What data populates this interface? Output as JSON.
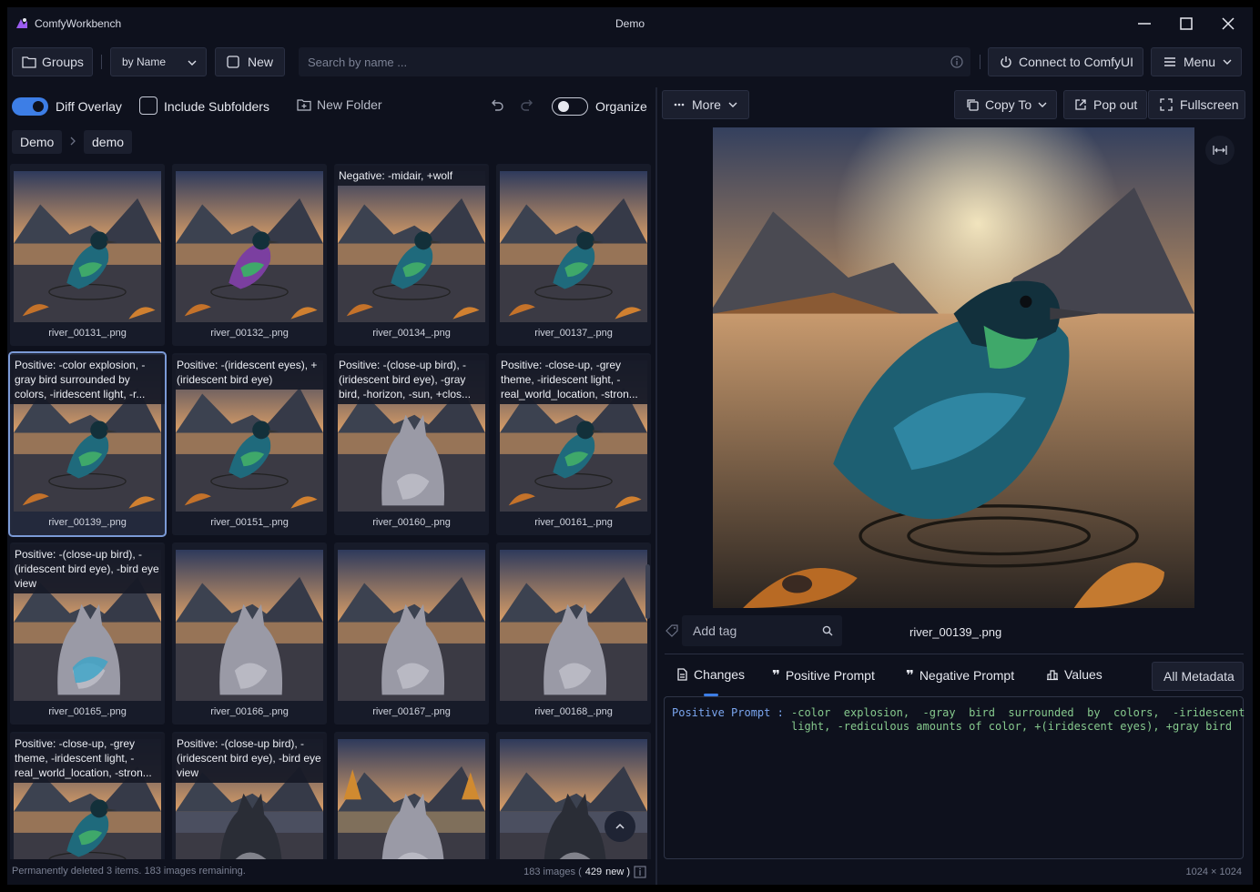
{
  "window": {
    "app_name": "ComfyWorkbench",
    "title": "Demo"
  },
  "toolbar": {
    "groups_label": "Groups",
    "sort_label": "by Name",
    "new_label": "New",
    "search_placeholder": "Search by name ...",
    "connect_label": "Connect to ComfyUI",
    "menu_label": "Menu"
  },
  "options": {
    "diff_overlay_label": "Diff Overlay",
    "diff_overlay_on": true,
    "include_subfolders_label": "Include Subfolders",
    "new_folder_label": "New Folder",
    "organize_label": "Organize",
    "organize_on": false
  },
  "breadcrumb": [
    "Demo",
    "demo"
  ],
  "gallery": {
    "tiles": [
      {
        "name": "river_00131_.png",
        "overlay": "",
        "scene": "bird-sunset",
        "selected": false
      },
      {
        "name": "river_00132_.png",
        "overlay": "",
        "scene": "bird-rainbow",
        "selected": false
      },
      {
        "name": "river_00134_.png",
        "overlay": "Negative: -midair, +wolf",
        "scene": "bird-ripples",
        "selected": false
      },
      {
        "name": "river_00137_.png",
        "overlay": "",
        "scene": "bird-mountain",
        "selected": false
      },
      {
        "name": "river_00139_.png",
        "overlay": "Positive: -color explosion, -gray bird surrounded by colors, -iridescent light, -r...",
        "scene": "bird-sunset",
        "selected": true
      },
      {
        "name": "river_00151_.png",
        "overlay": "Positive: -(iridescent eyes), +(iridescent bird eye)",
        "scene": "bird-mountain",
        "selected": false
      },
      {
        "name": "river_00160_.png",
        "overlay": "Positive: -(close-up bird), -(iridescent bird eye), -gray bird, -horizon, -sun, +clos...",
        "scene": "wolf-close",
        "selected": false
      },
      {
        "name": "river_00161_.png",
        "overlay": "Positive: -close-up, -grey theme, -iridescent light, -real_world_location, -stron...",
        "scene": "bird-small",
        "selected": false
      },
      {
        "name": "river_00165_.png",
        "overlay": "Positive: -(close-up bird), -(iridescent bird eye), -bird eye view",
        "scene": "wolf-rainbow",
        "selected": false
      },
      {
        "name": "river_00166_.png",
        "overlay": "",
        "scene": "wolf-back",
        "selected": false
      },
      {
        "name": "river_00167_.png",
        "overlay": "",
        "scene": "wolf-back",
        "selected": false
      },
      {
        "name": "river_00168_.png",
        "overlay": "",
        "scene": "wolf-sit",
        "selected": false
      },
      {
        "name": "",
        "overlay": "Positive: -close-up, -grey theme, -iridescent light, -real_world_location, -stron...",
        "scene": "bird-small",
        "selected": false
      },
      {
        "name": "",
        "overlay": "Positive: -(close-up bird), -(iridescent bird eye), -bird eye view",
        "scene": "wolf-dark",
        "selected": false
      },
      {
        "name": "",
        "overlay": "",
        "scene": "wolf-autumn",
        "selected": false
      },
      {
        "name": "",
        "overlay": "",
        "scene": "wolf-dark",
        "selected": false
      }
    ]
  },
  "status": {
    "message": "Permanently deleted 3 items. 183 images remaining.",
    "count_prefix": "183  images  (",
    "new_count": "429",
    "count_suffix": " new )"
  },
  "viewer": {
    "more_label": "More",
    "copy_to_label": "Copy To",
    "pop_out_label": "Pop out",
    "fullscreen_label": "Fullscreen",
    "tag_placeholder": "Add tag",
    "filename": "river_00139_.png",
    "tabs": {
      "changes": "Changes",
      "positive": "Positive Prompt",
      "negative": "Negative Prompt",
      "values": "Values",
      "all_metadata": "All Metadata"
    },
    "meta_key": "Positive Prompt :",
    "meta_value": "-color  explosion,  -gray  bird  surrounded  by  colors,  -iridescent\nlight, -rediculous amounts of color, +(iridescent eyes), +gray bird",
    "dimensions": "1024 × 1024"
  },
  "colors": {
    "accent": "#3d7ee6",
    "background": "#0e111d",
    "panel": "#1b1f2e",
    "meta_key": "#7aa5ee",
    "meta_value": "#86c98d"
  }
}
